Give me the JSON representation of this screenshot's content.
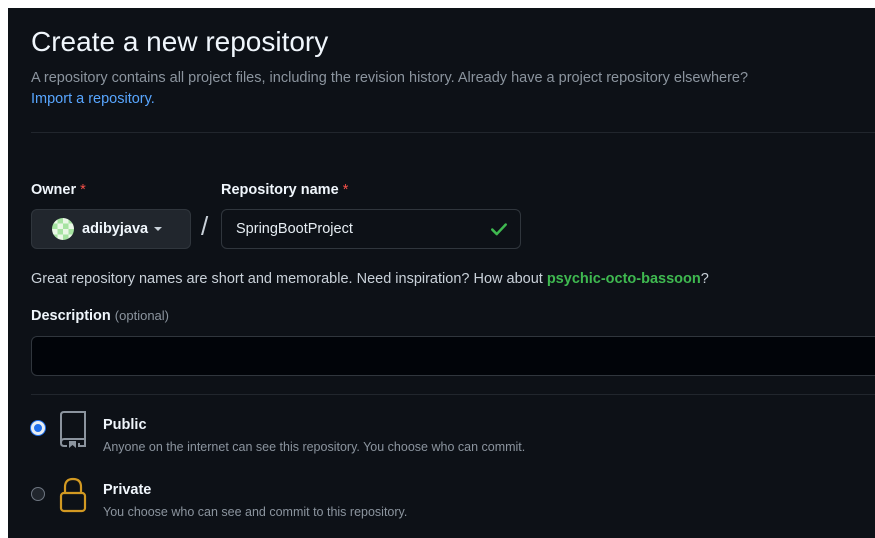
{
  "header": {
    "title": "Create a new repository",
    "subtitle": "A repository contains all project files, including the revision history. Already have a project repository elsewhere?",
    "import_link": "Import a repository."
  },
  "owner": {
    "label": "Owner",
    "required_mark": "*",
    "value": "adibyjava",
    "avatar_icon": "identicon-avatar"
  },
  "repository_name": {
    "label": "Repository name",
    "required_mark": "*",
    "value": "SpringBootProject",
    "valid": true,
    "separator": "/"
  },
  "name_hint": {
    "text": "Great repository names are short and memorable. Need inspiration? How about ",
    "suggestion": "psychic-octo-bassoon",
    "suffix": "?"
  },
  "description": {
    "label": "Description",
    "optional_label": "(optional)",
    "value": ""
  },
  "visibility": {
    "options": [
      {
        "title": "Public",
        "description": "Anyone on the internet can see this repository. You choose who can commit.",
        "icon": "repo-icon",
        "selected": true
      },
      {
        "title": "Private",
        "description": "You choose who can see and commit to this repository.",
        "icon": "lock-icon",
        "selected": false
      }
    ]
  },
  "colors": {
    "background": "#0d1117",
    "link": "#58a6ff",
    "success": "#3fb950",
    "required": "#f85149",
    "private_icon": "#d29922"
  }
}
